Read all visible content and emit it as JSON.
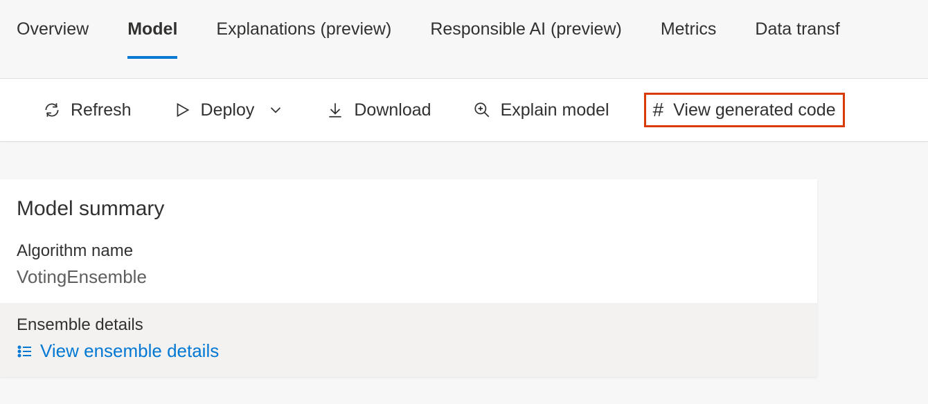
{
  "tabs": {
    "overview": "Overview",
    "model": "Model",
    "explanations": "Explanations (preview)",
    "responsible_ai": "Responsible AI (preview)",
    "metrics": "Metrics",
    "data_transf": "Data transf"
  },
  "toolbar": {
    "refresh": "Refresh",
    "deploy": "Deploy",
    "download": "Download",
    "explain_model": "Explain model",
    "view_generated_code": "View generated code"
  },
  "panel": {
    "title": "Model summary",
    "algorithm_label": "Algorithm name",
    "algorithm_value": "VotingEnsemble",
    "ensemble_label": "Ensemble details",
    "ensemble_link": "View ensemble details"
  }
}
